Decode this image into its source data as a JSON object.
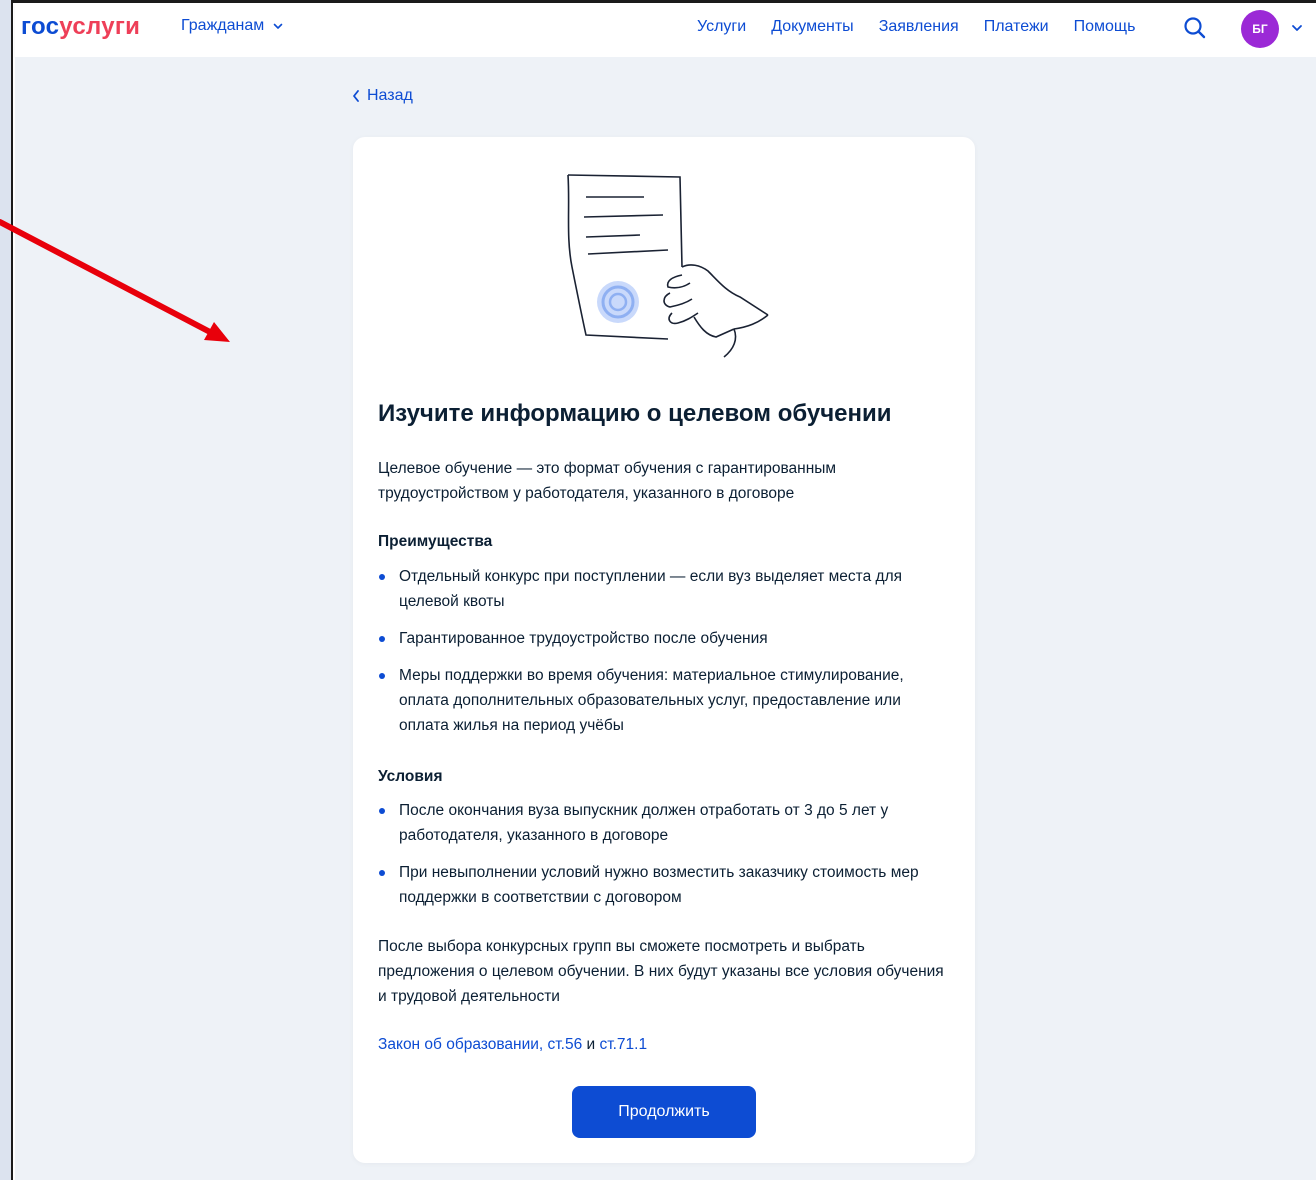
{
  "header": {
    "logo_part1": "гос",
    "logo_part2": "услуги",
    "audience": "Гражданам",
    "nav": [
      "Услуги",
      "Документы",
      "Заявления",
      "Платежи",
      "Помощь"
    ],
    "avatar_initials": "БГ"
  },
  "back_label": "Назад",
  "card": {
    "title": "Изучите информацию о целевом обучении",
    "intro": "Целевое обучение — это формат обучения с гарантированным трудоустройством у работодателя, указанного в договоре",
    "advantages_title": "Преимущества",
    "advantages": [
      "Отдельный конкурс при поступлении — если вуз выделяет места для целевой квоты",
      "Гарантированное трудоустройство после обучения",
      "Меры поддержки во время обучения: материальное стимулирование, оплата дополнительных образовательных услуг, предоставление или оплата жилья на период учёбы"
    ],
    "conditions_title": "Условия",
    "conditions": [
      "После окончания вуза выпускник должен отработать от 3 до 5 лет у работодателя, указанного в договоре",
      "При невыполнении условий нужно возместить заказчику стоимость мер поддержки в соответствии с договором"
    ],
    "outro": "После выбора конкурсных групп вы сможете посмотреть и выбрать предложения о целевом обучении. В них будут указаны все условия обучения и трудовой деятельности",
    "law_link1": "Закон об образовании, ст.56",
    "law_and": " и ",
    "law_link2": "ст.71.1",
    "continue_label": "Продолжить"
  },
  "colors": {
    "brand_blue": "#0d4cd3",
    "brand_red": "#ee3f58",
    "avatar_purple": "#9b29d6",
    "page_bg": "#eef2f7",
    "annotation_arrow": "#e8000b"
  }
}
